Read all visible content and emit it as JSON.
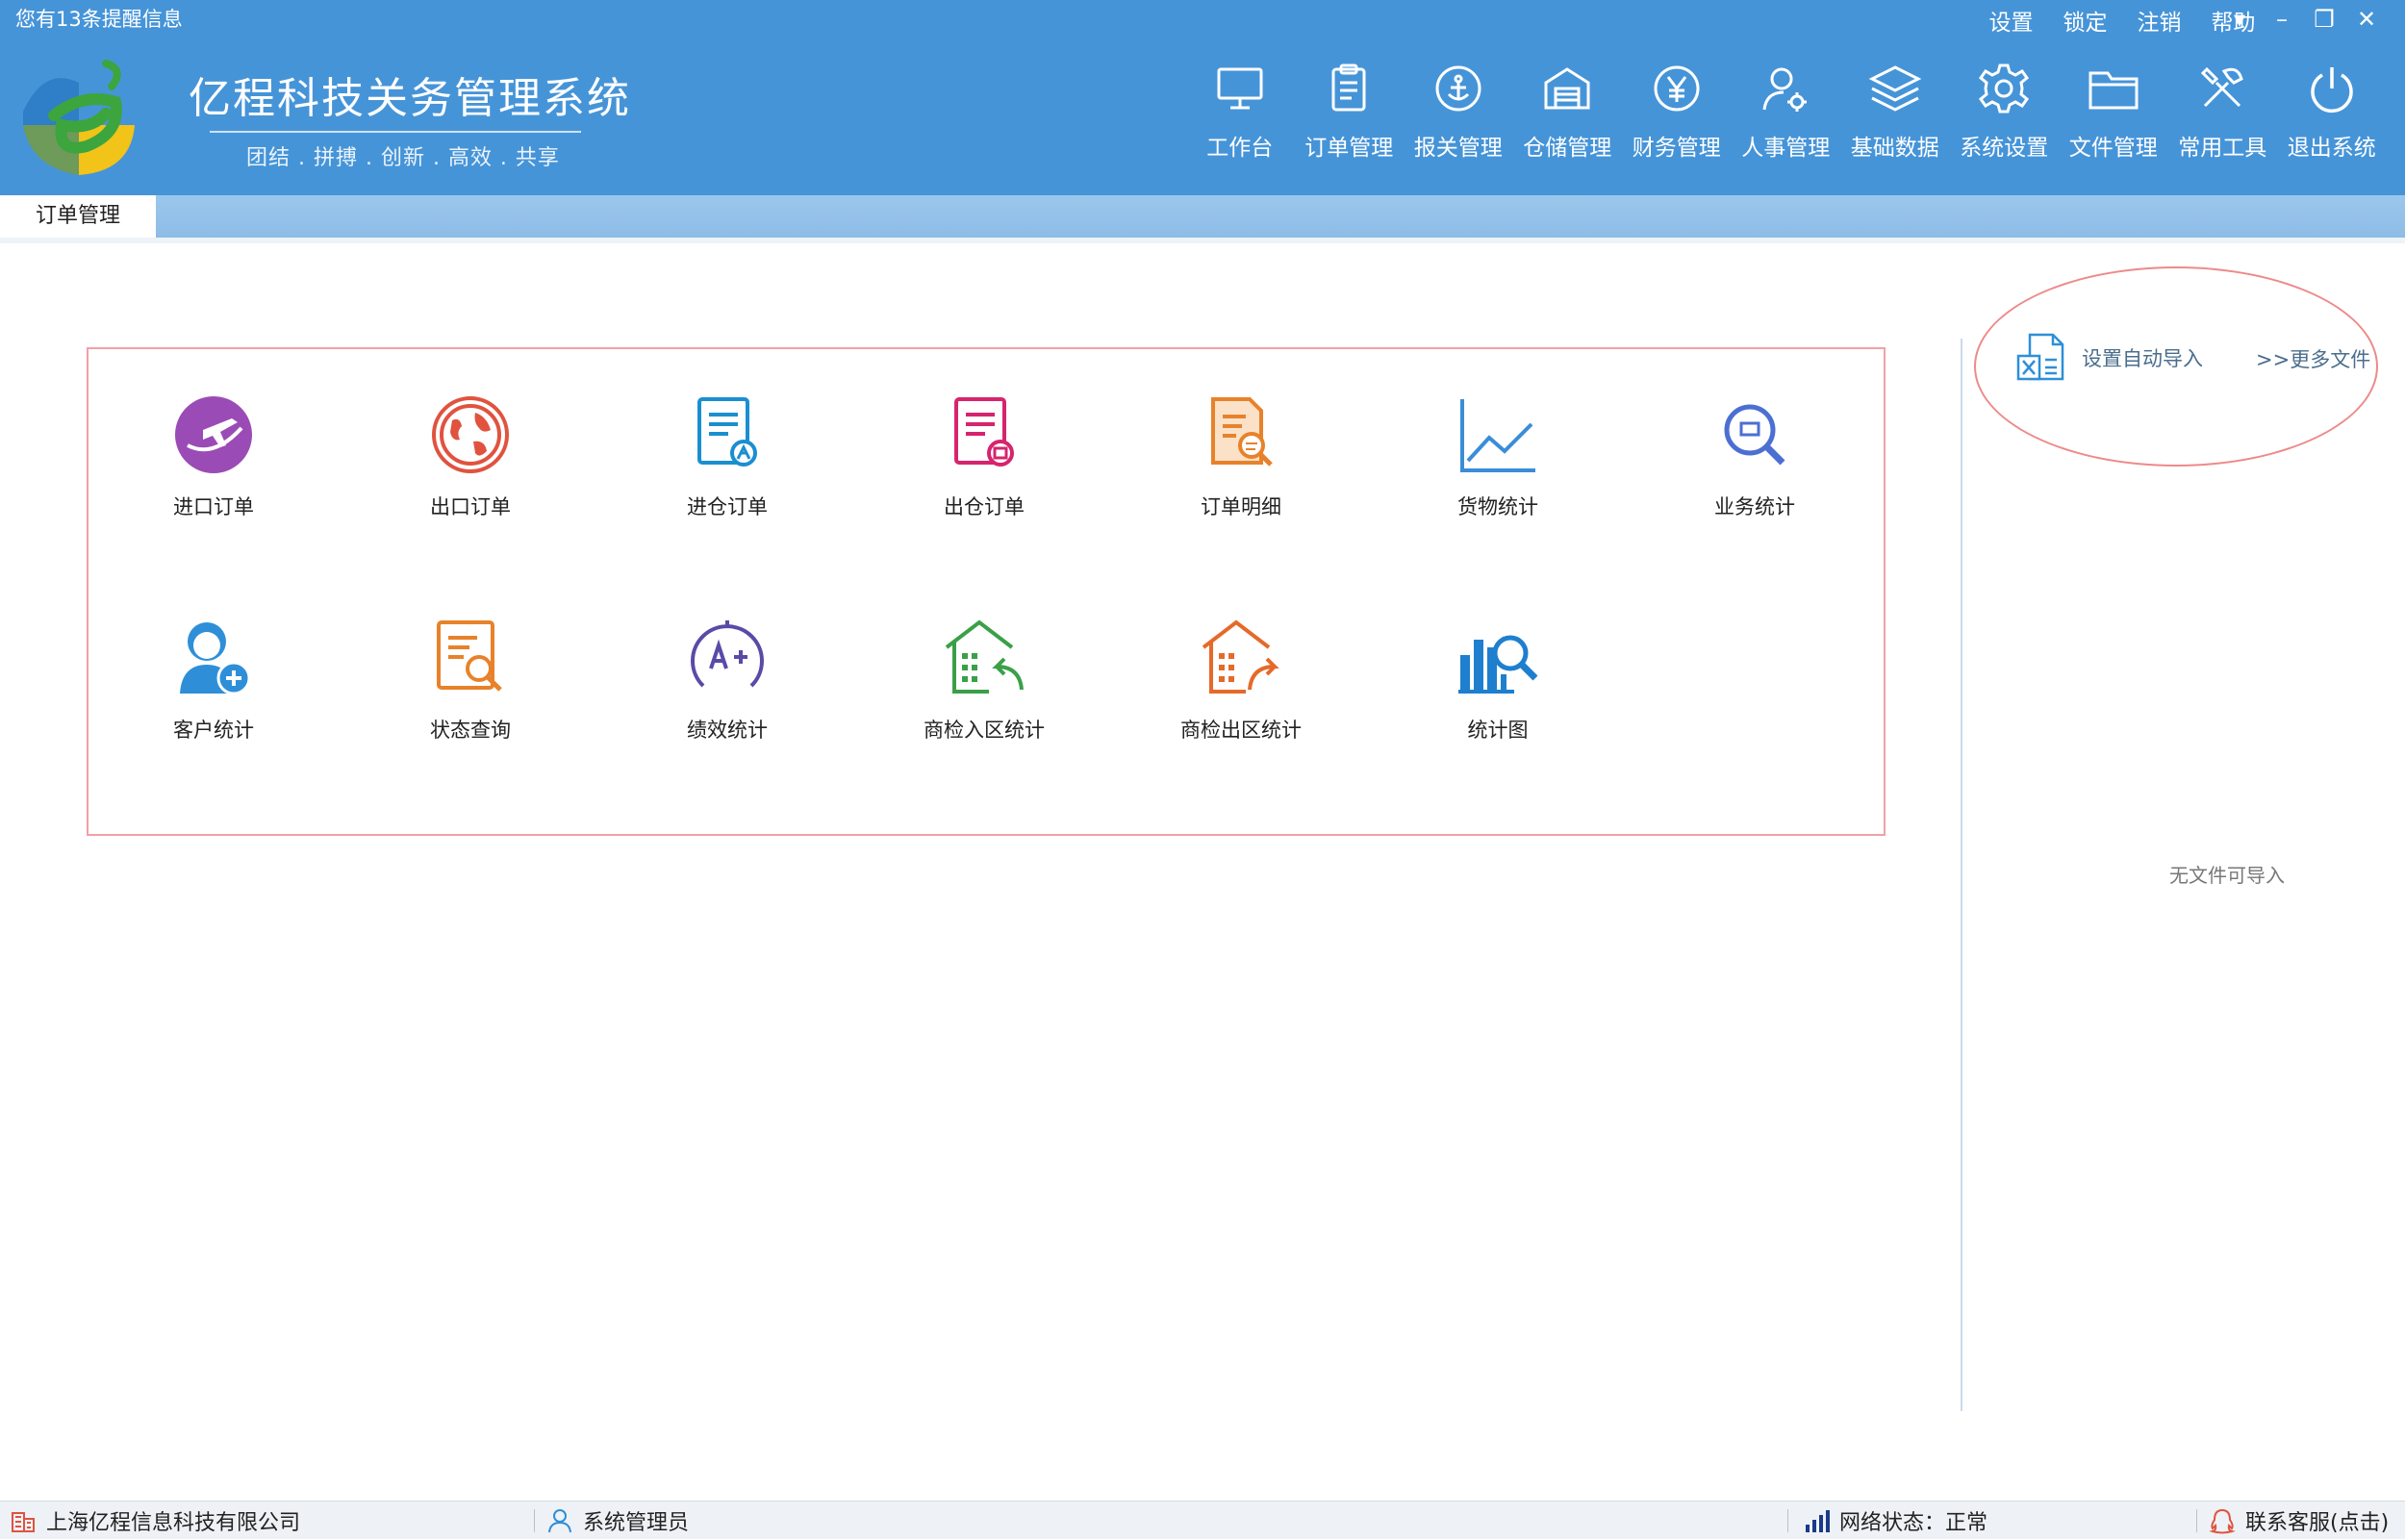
{
  "header": {
    "notice": "您有13条提醒信息",
    "top_links": [
      "设置",
      "锁定",
      "注销",
      "帮助"
    ],
    "window_controls": [
      {
        "icon": "menu-dropdown-icon",
        "glyph": "▾"
      },
      {
        "icon": "minimize-icon",
        "glyph": "–"
      },
      {
        "icon": "restore-icon",
        "glyph": "❐"
      },
      {
        "icon": "close-icon",
        "glyph": "✕"
      }
    ],
    "app_title": "亿程科技关务管理系统",
    "slogan": "团结 . 拼搏 . 创新 . 高效 . 共享",
    "nav": [
      {
        "label": "工作台",
        "icon": "monitor-icon"
      },
      {
        "label": "订单管理",
        "icon": "clipboard-icon"
      },
      {
        "label": "报关管理",
        "icon": "anchor-icon"
      },
      {
        "label": "仓储管理",
        "icon": "warehouse-icon"
      },
      {
        "label": "财务管理",
        "icon": "yen-icon"
      },
      {
        "label": "人事管理",
        "icon": "user-settings-icon"
      },
      {
        "label": "基础数据",
        "icon": "layers-icon"
      },
      {
        "label": "系统设置",
        "icon": "gear-icon"
      },
      {
        "label": "文件管理",
        "icon": "folder-icon"
      },
      {
        "label": "常用工具",
        "icon": "tools-icon"
      },
      {
        "label": "退出系统",
        "icon": "power-icon"
      }
    ]
  },
  "tabs": {
    "active": "订单管理"
  },
  "tiles": [
    {
      "label": "进口订单",
      "icon": "import-plane-icon",
      "color": "#9b4bb5"
    },
    {
      "label": "出口订单",
      "icon": "globe-icon",
      "color": "#e0533f"
    },
    {
      "label": "进仓订单",
      "icon": "doc-in-icon",
      "color": "#1a8fd0"
    },
    {
      "label": "出仓订单",
      "icon": "doc-out-icon",
      "color": "#d6246e"
    },
    {
      "label": "订单明细",
      "icon": "doc-search-icon",
      "color": "#e8822a"
    },
    {
      "label": "货物统计",
      "icon": "line-chart-icon",
      "color": "#3a8dd8"
    },
    {
      "label": "业务统计",
      "icon": "magnifier-icon",
      "color": "#4b6fd3"
    },
    {
      "label": "客户统计",
      "icon": "add-user-icon",
      "color": "#2e8fd8"
    },
    {
      "label": "状态查询",
      "icon": "list-search-icon",
      "color": "#e8822a"
    },
    {
      "label": "绩效统计",
      "icon": "grade-icon",
      "color": "#5a4aa8"
    },
    {
      "label": "商检入区统计",
      "icon": "building-in-icon",
      "color": "#3aa048"
    },
    {
      "label": "商检出区统计",
      "icon": "building-out-icon",
      "color": "#e56a2a"
    },
    {
      "label": "统计图",
      "icon": "bar-chart-search-icon",
      "color": "#1e7fcf"
    }
  ],
  "side": {
    "auto_import": "设置自动导入",
    "more_files": ">>更多文件",
    "empty_text": "无文件可导入"
  },
  "status": {
    "company": "上海亿程信息科技有限公司",
    "user": "系统管理员",
    "network": "网络状态：正常",
    "support": "联系客服(点击)"
  },
  "colors": {
    "header_bg": "#4694d8",
    "tab_strip": "#9cc7ec",
    "panel_border": "#f0a0a8"
  }
}
